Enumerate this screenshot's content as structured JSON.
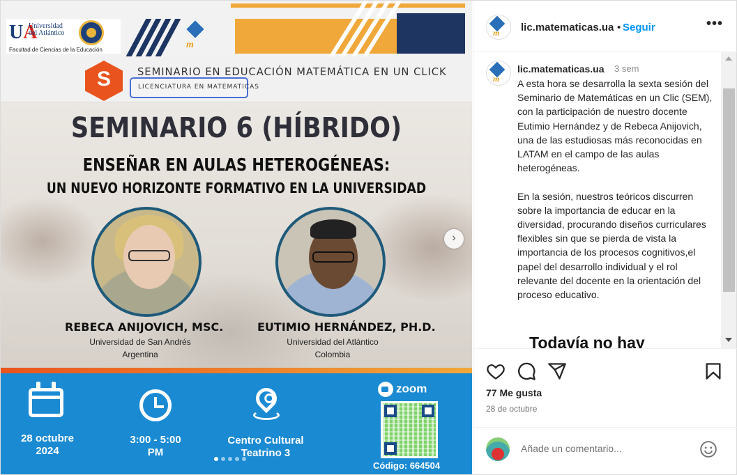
{
  "poster": {
    "university_line1": "Universidad",
    "university_line2": "del Atlántico",
    "faculty": "Facultad de Ciencias de la Educación",
    "seminar_header": "SEMINARIO EN EDUCACIÓN MATEMÁTICA EN UN CLICK",
    "program_label": "LICENCIATURA EN MATEMATICAS",
    "title": "SEMINARIO 6 (HÍBRIDO)",
    "subtitle_line1": "ENSEÑAR EN AULAS HETEROGÉNEAS:",
    "subtitle_line2": "UN NUEVO HORIZONTE FORMATIVO EN LA UNIVERSIDAD",
    "speakers": [
      {
        "name": "REBECA ANIJOVICH, MSC.",
        "affiliation": "Universidad de San Andrés",
        "country": "Argentina"
      },
      {
        "name": "EUTIMIO HERNÁNDEZ, PH.D.",
        "affiliation": "Universidad del Atlántico",
        "country": "Colombia"
      }
    ],
    "date_line1": "28 octubre",
    "date_line2": "2024",
    "time_line1": "3:00 - 5:00",
    "time_line2": "PM",
    "place_line1": "Centro Cultural",
    "place_line2": "Teatrino 3",
    "zoom_label": "zoom",
    "code": "Código: 664504"
  },
  "carousel": {
    "total_slides": 5,
    "active_slide": 1
  },
  "header": {
    "username": "lic.matematicas.ua",
    "separator": "•",
    "follow_label": "Seguir",
    "more_label": "•••"
  },
  "caption": {
    "username": "lic.matematicas.ua",
    "time": "3 sem",
    "text": "A esta hora se desarrolla la sexta sesión del Seminario de Matemáticas en un Clic (SEM), con la participación de nuestro docente Eutimio Hernández y de Rebeca Anijovich, una de las estudiosas más reconocidas en LATAM en el campo de las aulas heterogéneas.\n\nEn la sesión, nuestros teóricos discurren sobre la importancia de educar en la diversidad, procurando diseños curriculares flexibles sin que se pierda de vista la importancia de los procesos cognitivos,el papel del desarrollo individual y el rol relevante del docente en la orientación del proceso educativo.",
    "no_comments": "Todavía no hay"
  },
  "engagement": {
    "likes": "77 Me gusta",
    "date": "28 de octubre"
  },
  "comment_box": {
    "placeholder": "Añade un comentario..."
  },
  "colors": {
    "accent_blue": "#0095f6",
    "poster_blue": "#1a8ad3",
    "poster_orange": "#f0a83a",
    "poster_navy": "#1f3561"
  }
}
